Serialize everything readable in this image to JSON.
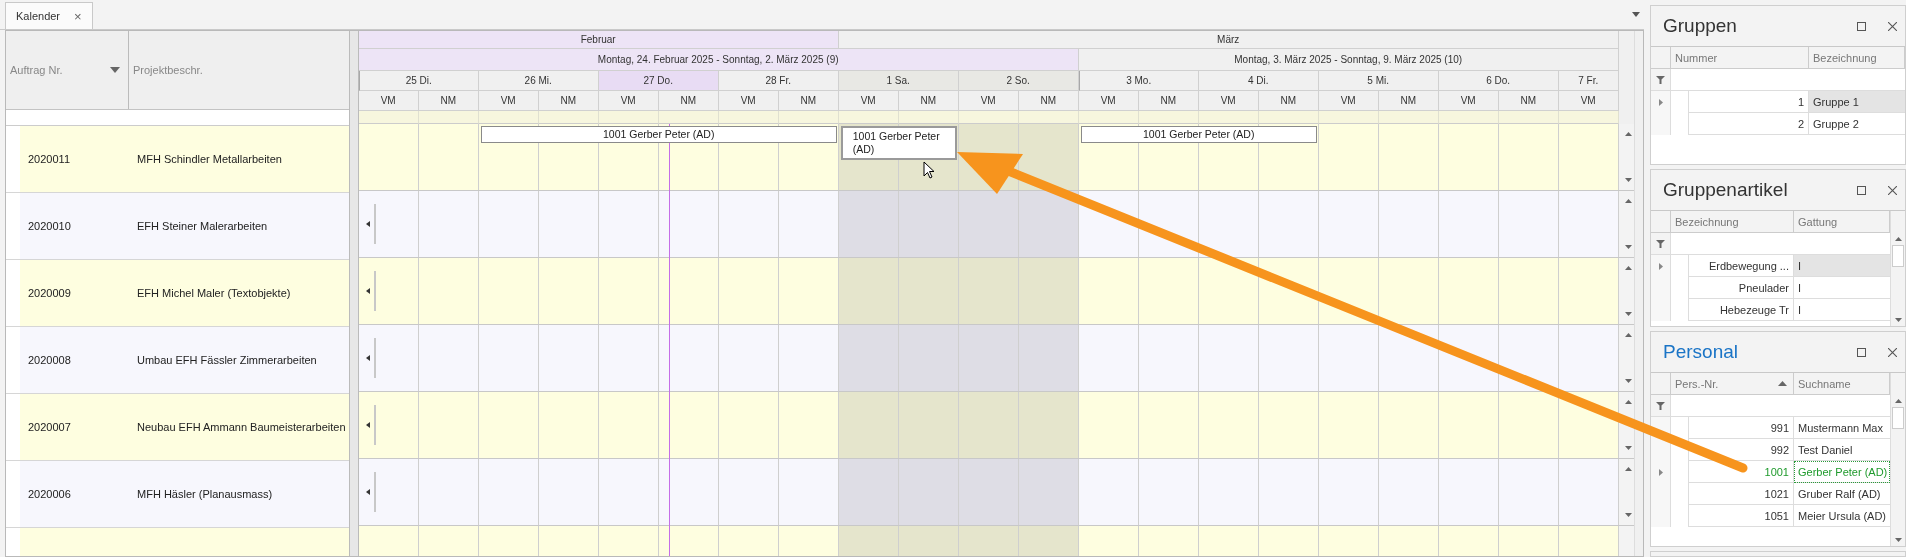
{
  "tab": {
    "label": "Kalender",
    "close": "×"
  },
  "orders": {
    "columns": [
      {
        "label": "Auftrag Nr.",
        "sort_desc": true
      },
      {
        "label": "Projektbeschr."
      }
    ],
    "rows": [
      {
        "number": "2020011",
        "name": "MFH Schindler Metallarbeiten",
        "cells": [
          {
            "kind": "free"
          },
          {
            "kind": "start",
            "text": "1001 Gerber Peter (AD)",
            "selected": false
          },
          {
            "kind": "cont"
          },
          {
            "kind": "cont"
          },
          {
            "kind": "start",
            "text": "1001 Gerber Peter (AD)",
            "selected": true
          },
          {
            "kind": "free"
          },
          {
            "kind": "start",
            "text": "1001 Gerber Peter (AD)",
            "selected": false
          },
          {
            "kind": "cont"
          },
          {
            "kind": "free"
          },
          {
            "kind": "free"
          },
          {
            "kind": "free"
          }
        ]
      },
      {
        "number": "2020010",
        "name": "EFH Steiner Malerarbeiten",
        "more_left": true
      },
      {
        "number": "2020009",
        "name": "EFH Michel Maler (Textobjekte)",
        "more_left": true
      },
      {
        "number": "2020008",
        "name": "Umbau EFH Fässler Zimmerarbeiten",
        "more_left": true
      },
      {
        "number": "2020007",
        "name": "Neubau EFH Ammann Baumeisterarbeiten",
        "more_left": true
      },
      {
        "number": "2020006",
        "name": "MFH Häsler (Planausmass)",
        "more_left": true
      }
    ]
  },
  "calendar": {
    "months": [
      {
        "label": "Februar",
        "current": true,
        "days": [
          {
            "label": "25 Di.",
            "today": false,
            "weekend": false,
            "week_start": true,
            "slots": [
              "VM",
              "NM"
            ]
          },
          {
            "label": "26 Mi.",
            "today": false,
            "weekend": false,
            "week_start": false,
            "slots": [
              "VM",
              "NM"
            ]
          },
          {
            "label": "27 Do.",
            "today": true,
            "weekend": false,
            "week_start": false,
            "slots": [
              "VM",
              "NM"
            ]
          },
          {
            "label": "28 Fr.",
            "today": false,
            "weekend": false,
            "week_start": false,
            "slots": [
              "VM",
              "NM"
            ]
          }
        ]
      },
      {
        "label": "März",
        "current": false,
        "days": [
          {
            "label": "1 Sa.",
            "today": false,
            "weekend": true,
            "week_start": false,
            "slots": [
              "VM",
              "NM"
            ]
          },
          {
            "label": "2 So.",
            "today": false,
            "weekend": true,
            "week_start": false,
            "slots": [
              "VM",
              "NM"
            ]
          },
          {
            "label": "3 Mo.",
            "today": false,
            "weekend": false,
            "week_start": true,
            "slots": [
              "VM",
              "NM"
            ]
          },
          {
            "label": "4 Di.",
            "today": false,
            "weekend": false,
            "week_start": false,
            "slots": [
              "VM",
              "NM"
            ]
          },
          {
            "label": "5 Mi.",
            "today": false,
            "weekend": false,
            "week_start": false,
            "slots": [
              "VM",
              "NM"
            ]
          },
          {
            "label": "6 Do.",
            "today": false,
            "weekend": false,
            "week_start": false,
            "slots": [
              "VM",
              "NM"
            ]
          },
          {
            "label": "7 Fr.",
            "today": false,
            "weekend": false,
            "week_start": false,
            "slots": [
              "VM"
            ]
          }
        ]
      }
    ],
    "weeks": [
      {
        "label": "Montag, 24. Februar 2025 - Sonntag, 2. März 2025 (9)",
        "current": true
      },
      {
        "label": "Montag, 3. März 2025 - Sonntag, 9. März 2025 (10)",
        "current": false
      }
    ]
  },
  "panels": [
    {
      "title": "Gruppen",
      "active": false,
      "columns": [
        {
          "label": "Nummer"
        },
        {
          "label": "Bezeichnung"
        }
      ],
      "rows": [
        {
          "cells": [
            "1",
            "Gruppe 1"
          ],
          "selected": true
        },
        {
          "cells": [
            "2",
            "Gruppe 2"
          ],
          "selected": false
        }
      ]
    },
    {
      "title": "Gruppenartikel",
      "active": false,
      "scrollbar": true,
      "columns": [
        {
          "label": "Bezeichnung"
        },
        {
          "label": "Gattung"
        }
      ],
      "rows": [
        {
          "cells": [
            "Erdbewegung ...",
            "I"
          ],
          "selected": true
        },
        {
          "cells": [
            "Pneulader",
            "I"
          ],
          "selected": false
        },
        {
          "cells": [
            "Hebezeuge Tr",
            "I"
          ],
          "selected": false
        }
      ]
    },
    {
      "title": "Personal",
      "active": true,
      "scrollbar": true,
      "columns": [
        {
          "label": "Pers.-Nr.",
          "sort_asc": true
        },
        {
          "label": "Suchname"
        }
      ],
      "rows": [
        {
          "cells": [
            "991",
            "Mustermann Max"
          ],
          "selected": false
        },
        {
          "cells": [
            "992",
            "Test Daniel"
          ],
          "selected": false
        },
        {
          "cells": [
            "1001",
            "Gerber Peter (AD)"
          ],
          "selected": true
        },
        {
          "cells": [
            "1021",
            "Gruber Ralf (AD)"
          ],
          "selected": false
        },
        {
          "cells": [
            "1051",
            "Meier Ursula (AD)"
          ],
          "selected": false
        }
      ]
    }
  ]
}
